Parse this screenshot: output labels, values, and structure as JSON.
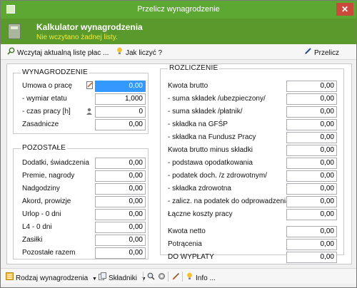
{
  "window": {
    "title": "Przelicz wynagrodzenie",
    "close_glyph": "✕"
  },
  "header": {
    "title": "Kalkulator wynagrodzenia",
    "subtitle": "Nie wczytano żadnej listy."
  },
  "toolbar": {
    "load_label": "Wczytaj aktualną listę płac ...",
    "howto_label": "Jak liczyć ?",
    "recalc_label": "Przelicz"
  },
  "wynagrodzenie": {
    "title": "WYNAGRODZENIE",
    "rows": [
      {
        "label": "Umowa o pracę",
        "value": "0,00"
      },
      {
        "label": "- wymiar etatu",
        "value": "1,000"
      },
      {
        "label": "- czas pracy [h]",
        "value": "0"
      },
      {
        "label": "Zasadnicze",
        "value": "0,00"
      }
    ]
  },
  "pozostale": {
    "title": "POZOSTAŁE",
    "rows": [
      {
        "label": "Dodatki, świadczenia",
        "value": "0,00"
      },
      {
        "label": "Premie, nagrody",
        "value": "0,00"
      },
      {
        "label": "Nadgodziny",
        "value": "0,00"
      },
      {
        "label": "Akord, prowizje",
        "value": "0,00"
      },
      {
        "label": "Urlop - 0 dni",
        "value": "0,00"
      },
      {
        "label": "L4 - 0 dni",
        "value": "0,00"
      },
      {
        "label": "Zasiłki",
        "value": "0,00"
      },
      {
        "label": "Pozostałe razem",
        "value": "0,00"
      }
    ]
  },
  "rozliczenie": {
    "title": "ROZLICZENIE",
    "rows": [
      {
        "label": "Kwota brutto",
        "value": "0,00"
      },
      {
        "label": "- suma składek /ubezpieczony/",
        "value": "0,00"
      },
      {
        "label": "- suma składek /płatnik/",
        "value": "0,00"
      },
      {
        "label": "- składka na GFŚP",
        "value": "0,00"
      },
      {
        "label": "- składka na Fundusz Pracy",
        "value": "0,00"
      },
      {
        "label": "Kwota brutto minus składki",
        "value": "0,00"
      },
      {
        "label": "- podstawa opodatkowania",
        "value": "0,00"
      },
      {
        "label": "- podatek doch. /z zdrowotnym/",
        "value": "0,00"
      },
      {
        "label": "- składka zdrowotna",
        "value": "0,00"
      },
      {
        "label": "- zalicz. na podatek do odprowadzenia",
        "value": "0,00"
      },
      {
        "label": "Łączne koszty pracy",
        "value": "0,00"
      },
      {
        "label": "Kwota netto",
        "value": "0,00"
      },
      {
        "label": "Potrącenia",
        "value": "0,00"
      },
      {
        "label": "DO WYPŁATY",
        "value": "0,00"
      }
    ]
  },
  "statusbar": {
    "rodzaj_label": "Rodzaj wynagrodzenia",
    "skladniki_label": "Składniki",
    "info_label": "Info ..."
  },
  "colors": {
    "titlebar": "#5da832",
    "header": "#5a9a2c",
    "subtitle": "#f1ea3a",
    "close": "#c9493a",
    "selection": "#3399ff"
  }
}
